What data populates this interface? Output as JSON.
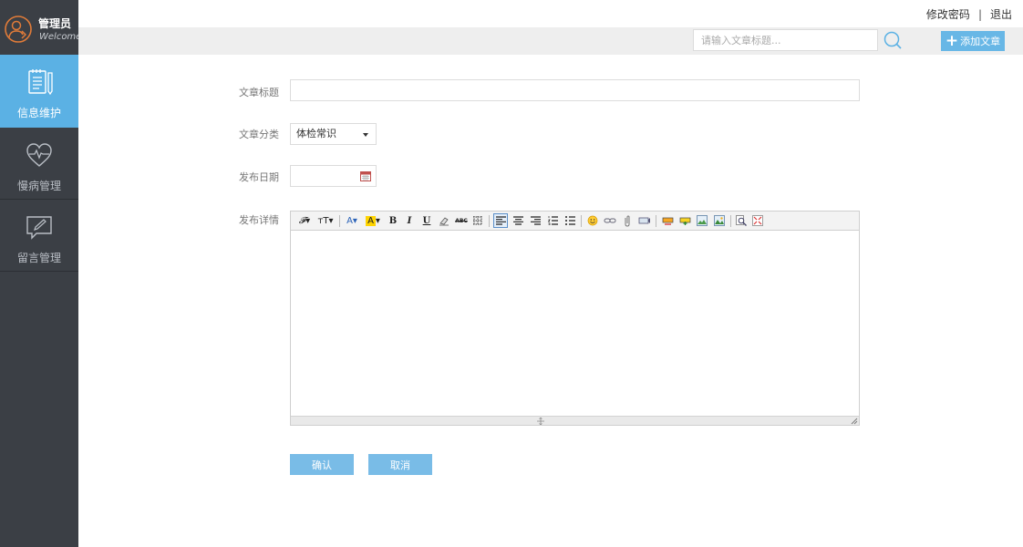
{
  "brand": {
    "name": "管理员",
    "welcome": "Welcome"
  },
  "sidebar": {
    "items": [
      {
        "label": "信息维护",
        "icon": "document-icon",
        "active": true
      },
      {
        "label": "慢病管理",
        "icon": "heart-pulse-icon",
        "active": false
      },
      {
        "label": "留言管理",
        "icon": "message-edit-icon",
        "active": false
      }
    ]
  },
  "header": {
    "change_password": "修改密码",
    "separator": "|",
    "logout": "退出",
    "search_placeholder": "请输入文章标题...",
    "add_label": "添加文章"
  },
  "form": {
    "title_label": "文章标题",
    "category_label": "文章分类",
    "category_value": "体检常识",
    "date_label": "发布日期",
    "detail_label": "发布详情",
    "confirm": "确认",
    "cancel": "取消"
  },
  "colors": {
    "sidebar_bg": "#3b3f45",
    "active": "#5bb1e4",
    "accent_button": "#68b7e6"
  }
}
